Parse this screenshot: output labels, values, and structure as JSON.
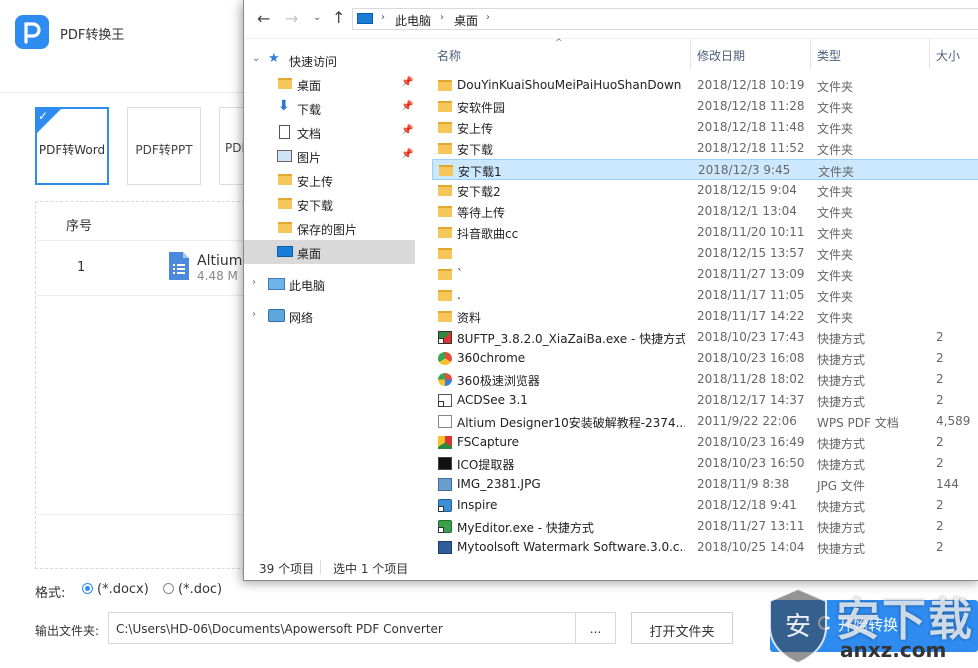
{
  "app": {
    "title": "PDF转换王",
    "logo_letter": "P",
    "modes": [
      {
        "label": "PDF转Word",
        "selected": true
      },
      {
        "label": "PDF转PPT",
        "selected": false
      },
      {
        "label": "PDF",
        "selected": false
      }
    ],
    "check_mark": "✓",
    "file_table": {
      "index_header": "序号",
      "rows": [
        {
          "index": "1",
          "name": "Altium",
          "size": "4.48 M"
        }
      ]
    },
    "format": {
      "label": "格式:",
      "options": [
        {
          "label": "(*.docx)",
          "selected": true
        },
        {
          "label": "(*.doc)",
          "selected": false
        }
      ]
    },
    "output": {
      "label": "输出文件夹:",
      "path": "C:\\Users\\HD-06\\Documents\\Apowersoft PDF Converter",
      "browse_label": "...",
      "open_folder_label": "打开文件夹",
      "start_label": "开始转换"
    },
    "accent_color": "#2e8bf0"
  },
  "watermark": {
    "big_text": "安下载",
    "small_text": "anxz.com",
    "shield_char": "安"
  },
  "explorer": {
    "nav_buttons": {
      "back": "←",
      "forward": "→",
      "recent": "⌄",
      "up": "↑"
    },
    "breadcrumb": [
      "此电脑",
      "桌面"
    ],
    "crumb_separator": "›",
    "nav_pane": {
      "quick_access": "快速访问",
      "items": [
        {
          "label": "桌面",
          "icon": "folder-icon",
          "pinned": true
        },
        {
          "label": "下载",
          "icon": "download-icon",
          "pinned": true
        },
        {
          "label": "文档",
          "icon": "document-icon",
          "pinned": true
        },
        {
          "label": "图片",
          "icon": "picture-icon",
          "pinned": true
        },
        {
          "label": "安上传",
          "icon": "folder-icon",
          "pinned": false
        },
        {
          "label": "安下载",
          "icon": "folder-icon",
          "pinned": false
        },
        {
          "label": "保存的图片",
          "icon": "folder-icon",
          "pinned": false
        },
        {
          "label": "桌面",
          "icon": "desktop-icon",
          "pinned": false,
          "selected": true
        }
      ],
      "this_pc": "此电脑",
      "network": "网络",
      "pin_glyph": "📌",
      "expand_glyph": "›",
      "expanded_glyph": "⌄"
    },
    "columns": {
      "name": "名称",
      "date": "修改日期",
      "type": "类型",
      "size": "大小"
    },
    "sort_glyph": "^",
    "files": [
      {
        "name": "DouYinKuaiShouMeiPaiHuoShanDown",
        "date": "2018/12/18 10:19",
        "type": "文件夹",
        "size": "",
        "icon": "folder"
      },
      {
        "name": "安软件园",
        "date": "2018/12/18 11:28",
        "type": "文件夹",
        "size": "",
        "icon": "folder"
      },
      {
        "name": "安上传",
        "date": "2018/12/18 11:48",
        "type": "文件夹",
        "size": "",
        "icon": "folder"
      },
      {
        "name": "安下载",
        "date": "2018/12/18 11:52",
        "type": "文件夹",
        "size": "",
        "icon": "folder"
      },
      {
        "name": "安下载1",
        "date": "2018/12/3 9:45",
        "type": "文件夹",
        "size": "",
        "icon": "folder",
        "selected": true
      },
      {
        "name": "安下载2",
        "date": "2018/12/15 9:04",
        "type": "文件夹",
        "size": "",
        "icon": "folder"
      },
      {
        "name": "等待上传",
        "date": "2018/12/1 13:04",
        "type": "文件夹",
        "size": "",
        "icon": "folder"
      },
      {
        "name": "抖音歌曲cc",
        "date": "2018/11/20 10:11",
        "type": "文件夹",
        "size": "",
        "icon": "folder"
      },
      {
        "name": "",
        "date": "2018/12/15 13:57",
        "type": "文件夹",
        "size": "",
        "icon": "folder"
      },
      {
        "name": "`",
        "date": "2018/11/27 13:09",
        "type": "文件夹",
        "size": "",
        "icon": "folder"
      },
      {
        "name": ".",
        "date": "2018/11/17 11:05",
        "type": "文件夹",
        "size": "",
        "icon": "folder"
      },
      {
        "name": "资料",
        "date": "2018/11/17 14:22",
        "type": "文件夹",
        "size": "",
        "icon": "folder"
      },
      {
        "name": "8UFTP_3.8.2.0_XiaZaiBa.exe - 快捷方式",
        "date": "2018/10/23 17:43",
        "type": "快捷方式",
        "size": "2",
        "icon": "exe"
      },
      {
        "name": "360chrome",
        "date": "2018/10/23 16:08",
        "type": "快捷方式",
        "size": "2",
        "icon": "chrome"
      },
      {
        "name": "360极速浏览器",
        "date": "2018/11/28 18:02",
        "type": "快捷方式",
        "size": "2",
        "icon": "360"
      },
      {
        "name": "ACDSee 3.1",
        "date": "2018/12/17 14:37",
        "type": "快捷方式",
        "size": "2",
        "icon": "acd"
      },
      {
        "name": "Altium Designer10安装破解教程-2374...",
        "date": "2011/9/22 22:06",
        "type": "WPS PDF 文档",
        "size": "4,589",
        "icon": "pdf"
      },
      {
        "name": "FSCapture",
        "date": "2018/10/23 16:49",
        "type": "快捷方式",
        "size": "2",
        "icon": "fsc"
      },
      {
        "name": "ICO提取器",
        "date": "2018/10/23 16:50",
        "type": "快捷方式",
        "size": "2",
        "icon": "ico"
      },
      {
        "name": "IMG_2381.JPG",
        "date": "2018/11/9 8:38",
        "type": "JPG 文件",
        "size": "144",
        "icon": "jpg"
      },
      {
        "name": "Inspire",
        "date": "2018/12/18 9:41",
        "type": "快捷方式",
        "size": "2",
        "icon": "insp"
      },
      {
        "name": "MyEditor.exe - 快捷方式",
        "date": "2018/11/27 13:11",
        "type": "快捷方式",
        "size": "2",
        "icon": "myed"
      },
      {
        "name": "Mytoolsoft Watermark Software.3.0.c...",
        "date": "2018/10/25 14:04",
        "type": "快捷方式",
        "size": "2",
        "icon": "mytool"
      }
    ],
    "status": {
      "count": "39 个项目",
      "selected": "选中 1 个项目"
    }
  }
}
